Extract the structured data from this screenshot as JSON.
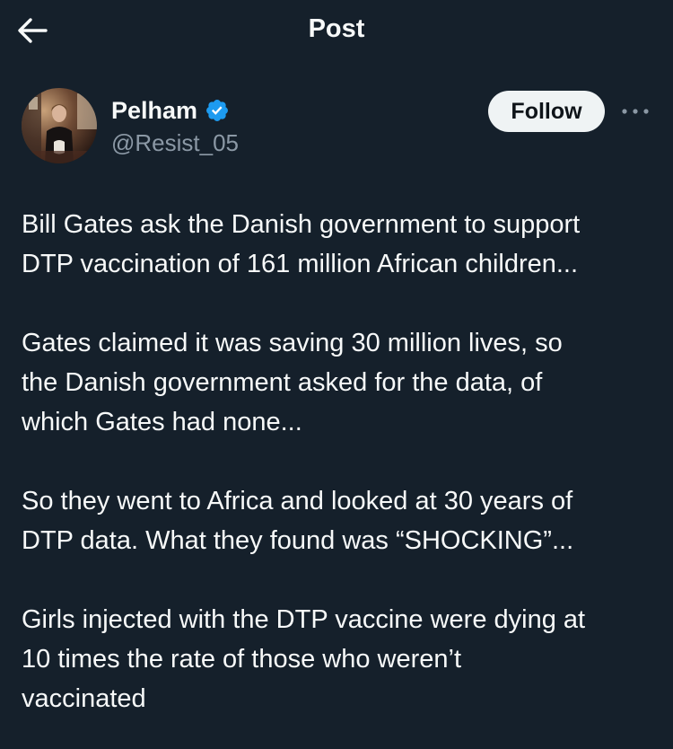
{
  "header": {
    "title": "Post",
    "back_icon": "arrow-left-icon"
  },
  "author": {
    "display_name": "Pelham",
    "handle": "@Resist_05",
    "verified": true,
    "verified_color": "#1d9bf0"
  },
  "actions": {
    "follow_label": "Follow",
    "more_icon": "more-horizontal-icon"
  },
  "tweet": {
    "paragraphs": [
      "Bill Gates ask the Danish government to support\nDTP vaccination of 161 million African children...",
      "Gates claimed it was saving 30 million lives, so\nthe Danish government asked for the data, of\nwhich Gates had none...",
      "So they went to Africa and looked at 30 years of\nDTP data. What they found was “SHOCKING”...",
      "Girls injected with the DTP vaccine were dying at\n10 times the rate of those who weren’t\nvaccinated"
    ]
  },
  "colors": {
    "background": "#15202b",
    "text": "#f7f9f9",
    "secondary_text": "#8b98a5",
    "follow_bg": "#eff3f4",
    "follow_text": "#0f1419"
  }
}
